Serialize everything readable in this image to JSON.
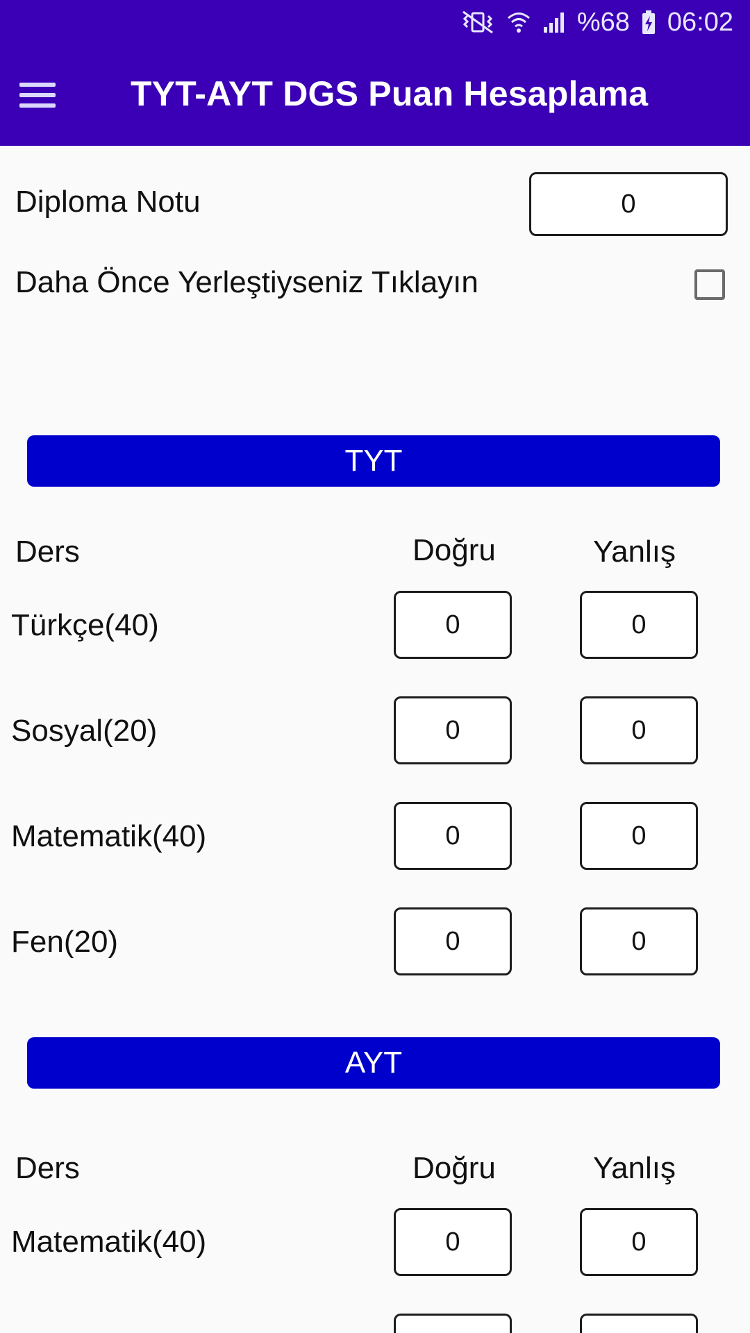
{
  "status_bar": {
    "battery_text": "%68",
    "time": "06:02",
    "icons": [
      "mute-vibrate-icon",
      "wifi-icon",
      "signal-icon",
      "battery-charging-icon"
    ]
  },
  "app_bar": {
    "title": "TYT-AYT DGS Puan Hesaplama",
    "menu_icon": "hamburger-menu-icon"
  },
  "form": {
    "diploma_label": "Diploma Notu",
    "diploma_value": "0",
    "placed_before_label": "Daha Önce Yerleştiyseniz Tıklayın",
    "placed_before_checked": false
  },
  "tyt": {
    "button_label": "TYT",
    "header": {
      "ders": "Ders",
      "dogru": "Doğru",
      "yanlis": "Yanlış"
    },
    "rows": [
      {
        "label": "Türkçe(40)",
        "dogru": "0",
        "yanlis": "0"
      },
      {
        "label": "Sosyal(20)",
        "dogru": "0",
        "yanlis": "0"
      },
      {
        "label": "Matematik(40)",
        "dogru": "0",
        "yanlis": "0"
      },
      {
        "label": "Fen(20)",
        "dogru": "0",
        "yanlis": "0"
      }
    ]
  },
  "ayt": {
    "button_label": "AYT",
    "header": {
      "ders": "Ders",
      "dogru": "Doğru",
      "yanlis": "Yanlış"
    },
    "rows": [
      {
        "label": "Matematik(40)",
        "dogru": "0",
        "yanlis": "0"
      }
    ]
  },
  "colors": {
    "app_bar": "#3b00b5",
    "section_button": "#0000cd",
    "background": "#fafafa"
  }
}
